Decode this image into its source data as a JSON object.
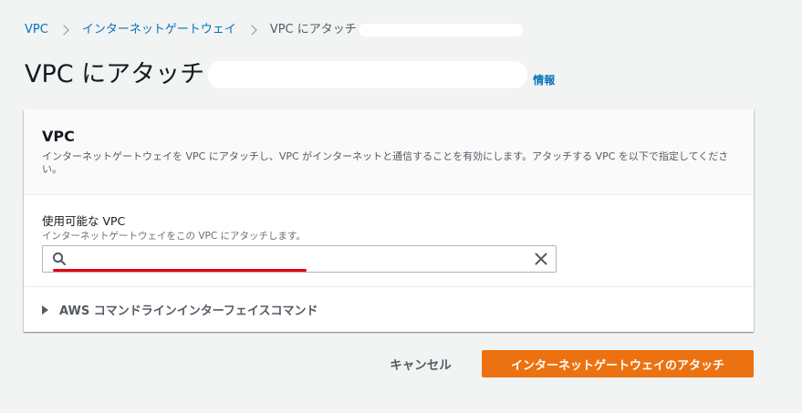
{
  "breadcrumb": {
    "items": [
      {
        "label": "VPC"
      },
      {
        "label": "インターネットゲートウェイ"
      },
      {
        "label": "VPC にアタッチ"
      }
    ]
  },
  "header": {
    "title": "VPC にアタッチ",
    "info_link": "情報"
  },
  "card": {
    "title": "VPC",
    "description": "インターネットゲートウェイを VPC にアタッチし、VPC がインターネットと通信することを有効にします。アタッチする VPC を以下で指定してください。",
    "field": {
      "label": "使用可能な VPC",
      "description": "インターネットゲートウェイをこの VPC にアタッチします。",
      "value": "",
      "placeholder": ""
    },
    "expander_label": "AWS コマンドラインインターフェイスコマンド"
  },
  "footer": {
    "cancel_label": "キャンセル",
    "submit_label": "インターネットゲートウェイのアタッチ"
  },
  "colors": {
    "link": "#0073bb",
    "primary": "#ec7211",
    "annotation_underline": "#e4000f",
    "background": "#f2f3f3"
  },
  "icons": [
    "chevron-right-icon",
    "search-icon",
    "close-icon",
    "caret-right-icon"
  ]
}
